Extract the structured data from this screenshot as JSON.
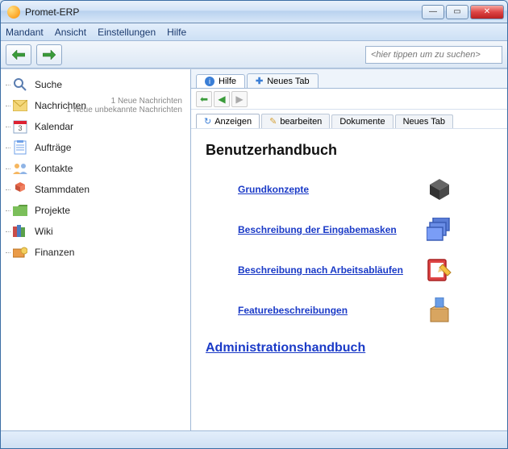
{
  "window": {
    "title": "Promet-ERP"
  },
  "menu": {
    "items": [
      "Mandant",
      "Ansicht",
      "Einstellungen",
      "Hilfe"
    ]
  },
  "toolbar": {
    "search_placeholder": "<hier tippen um zu suchen>"
  },
  "sidebar": {
    "items": [
      {
        "label": "Suche",
        "icon": "magnifier",
        "color": "#8fb4e6"
      },
      {
        "label": "Nachrichten",
        "icon": "envelope",
        "color": "#f4d77a",
        "badges": [
          "1 Neue Nachrichten",
          "1 Neue unbekannte Nachrichten"
        ]
      },
      {
        "label": "Kalendar",
        "icon": "calendar",
        "color": "#a7d6f4"
      },
      {
        "label": "Aufträge",
        "icon": "clipboard",
        "color": "#6fa0e8"
      },
      {
        "label": "Kontakte",
        "icon": "people",
        "color": "#f6b65f"
      },
      {
        "label": "Stammdaten",
        "icon": "database",
        "color": "#e96b4b"
      },
      {
        "label": "Projekte",
        "icon": "folder",
        "color": "#7bbf5a"
      },
      {
        "label": "Wiki",
        "icon": "books",
        "color": "#c94d49"
      },
      {
        "label": "Finanzen",
        "icon": "money",
        "color": "#ea9b48"
      }
    ]
  },
  "rightpane": {
    "toptabs": [
      {
        "label": "Hilfe",
        "active": true,
        "icon": "info"
      },
      {
        "label": "Neues Tab",
        "active": false,
        "icon": "plus"
      }
    ],
    "subtabs": [
      {
        "label": "Anzeigen",
        "active": true,
        "icon": "refresh"
      },
      {
        "label": "bearbeiten",
        "active": false,
        "icon": "pencil"
      },
      {
        "label": "Dokumente",
        "active": false,
        "icon": ""
      },
      {
        "label": "Neues Tab",
        "active": false,
        "icon": ""
      }
    ],
    "content": {
      "heading": "Benutzerhandbuch",
      "links": [
        {
          "label": "Grundkonzepte",
          "icon": "cube"
        },
        {
          "label": "Beschreibung der Eingabemasken",
          "icon": "windows"
        },
        {
          "label": "Beschreibung nach Arbeitsabläufen",
          "icon": "note-pencil"
        },
        {
          "label": "Featurebeschreibungen",
          "icon": "box"
        }
      ],
      "admin_link": "Administrationshandbuch"
    }
  }
}
